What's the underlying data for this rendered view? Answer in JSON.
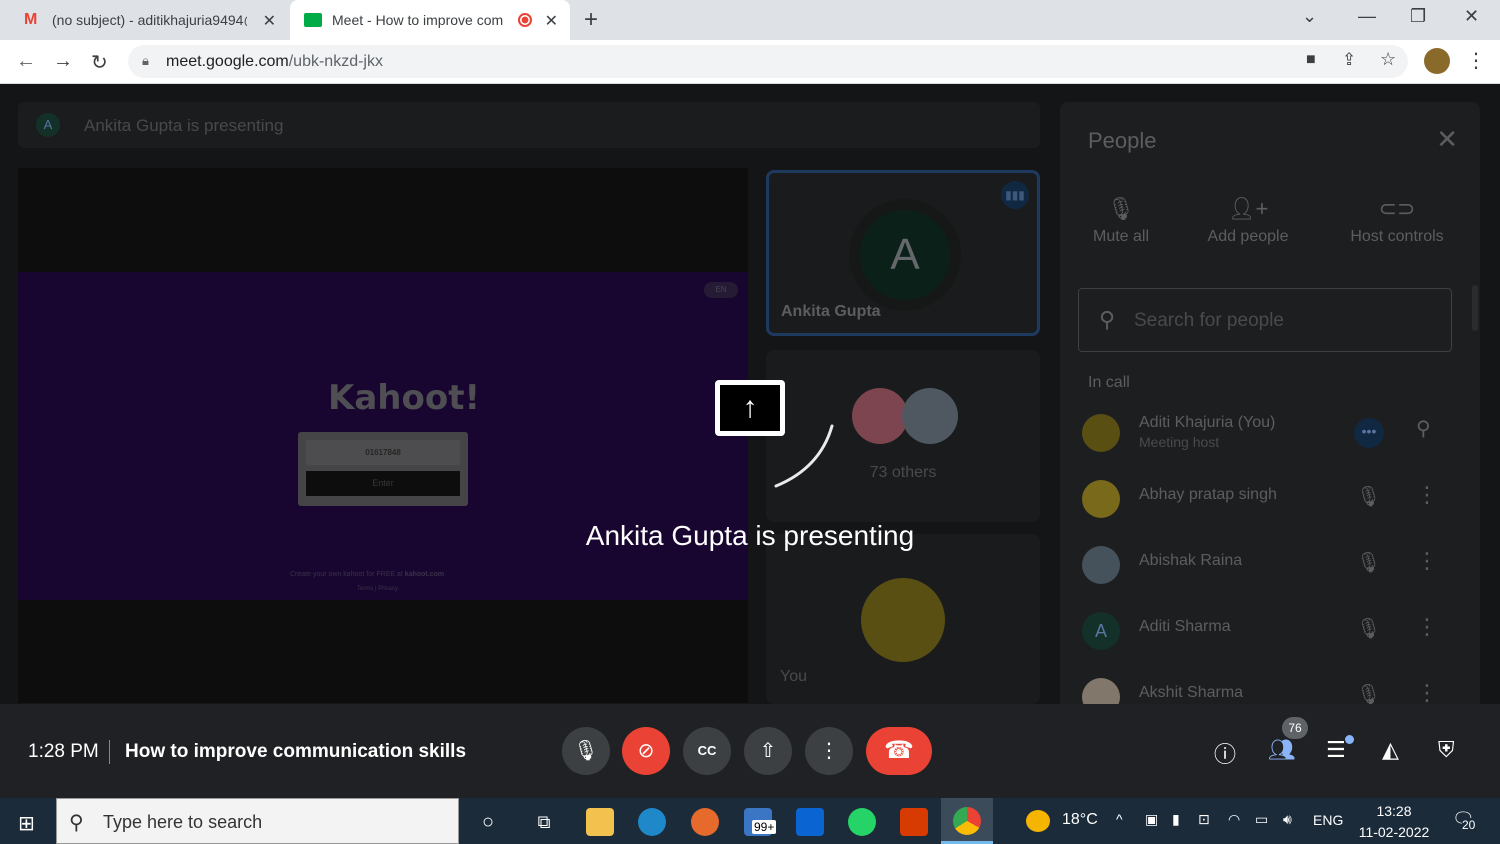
{
  "browser": {
    "tabs": [
      {
        "title": "(no subject) - aditikhajuria9494@",
        "icon": "gmail-icon"
      },
      {
        "title": "Meet - How to improve com",
        "icon": "meet-icon",
        "recording": true
      }
    ],
    "url_host": "meet.google.com",
    "url_path": "/ubk-nkzd-jkx"
  },
  "presenting_bar": {
    "avatar_letter": "A",
    "text": "Ankita Gupta is presenting"
  },
  "shared_screen": {
    "logo": "Kahoot!",
    "game_pin": "01617848",
    "enter_label": "Enter",
    "lang": "EN",
    "footer_text": "Create your own kahoot for FREE at",
    "footer_link": "kahoot.com",
    "footer_links2": "Terms | Privacy"
  },
  "tiles": {
    "presenter": {
      "letter": "A",
      "name": "Ankita Gupta"
    },
    "others": {
      "count_label": "73 others"
    },
    "self": {
      "name": "You"
    }
  },
  "overlay": {
    "text": "Ankita Gupta is presenting"
  },
  "people_panel": {
    "title": "People",
    "actions": [
      {
        "label": "Mute all",
        "icon": "mic-off-icon"
      },
      {
        "label": "Add people",
        "icon": "add-person-icon"
      },
      {
        "label": "Host controls",
        "icon": "toggle-icon"
      }
    ],
    "search_placeholder": "Search for people",
    "section_label": "In call",
    "participants": [
      {
        "name": "Aditi Khajuria (You)",
        "role": "Meeting host",
        "avatar_color": "#8a7a1c"
      },
      {
        "name": "Abhay pratap singh",
        "role": "",
        "avatar_color": "#b8a22a"
      },
      {
        "name": "Abishak Raina",
        "role": "",
        "avatar_color": "#6a7e8e"
      },
      {
        "name": "Aditi Sharma",
        "role": "",
        "avatar_letter": "A",
        "avatar_color": "#1e4a40"
      },
      {
        "name": "Akshit Sharma",
        "role": "",
        "avatar_color": "#c7b7a4"
      }
    ]
  },
  "meeting_bar": {
    "time": "1:28 PM",
    "title": "How to improve communication skills",
    "participant_count": "76"
  },
  "taskbar": {
    "search_placeholder": "Type here to search",
    "mail_badge": "99+",
    "weather": "18°C",
    "language": "ENG",
    "clock_time": "13:28",
    "clock_date": "11-02-2022",
    "notification_count": "20"
  }
}
